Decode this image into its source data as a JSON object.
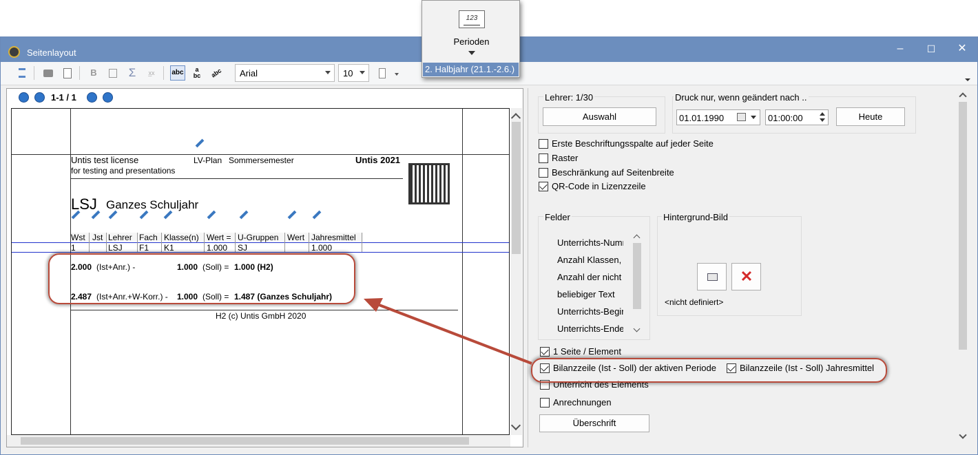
{
  "window": {
    "title": "Seitenlayout",
    "minimize": "–",
    "maximize": "☐",
    "close": "✕"
  },
  "toolbar": {
    "font": "Arial",
    "size": "10"
  },
  "popup": {
    "icon_text": "123",
    "label": "Perioden",
    "value": "2. Halbjahr (21.1.-2.6.)"
  },
  "preview": {
    "page_indicator": "1-1 / 1",
    "license1": "Untis test license",
    "license2": "for testing and presentations",
    "plan": "LV-Plan",
    "semester": "Sommersemester",
    "product": "Untis 2021",
    "code": "LSJ",
    "name": "Ganzes Schuljahr",
    "headers": [
      "Wst",
      "Jst",
      "Lehrer",
      "Fach",
      "Klasse(n)",
      "Wert =",
      "U-Gruppen",
      "Wert",
      "Jahresmittel"
    ],
    "row": [
      "1",
      "",
      "LSJ",
      "F1",
      "K1",
      "1.000",
      "SJ",
      "",
      "1.000"
    ],
    "bal1": {
      "v1": "2.000",
      "t1": "(Ist+Anr.) -",
      "v2": "1.000",
      "t2": "(Soll) =",
      "res": "1.000 (H2)"
    },
    "bal2": {
      "v1": "2.487",
      "t1": "(Ist+Anr.+W-Korr.) -",
      "v2": "1.000",
      "t2": "(Soll) =",
      "res": "1.487 (Ganzes Schuljahr)"
    },
    "footer": "H2   (c) Untis GmbH 2020"
  },
  "settings": {
    "teacher_label": "Lehrer: 1/30",
    "select_btn": "Auswahl",
    "print_label": "Druck nur, wenn geändert nach ..",
    "date": "01.01.1990",
    "time": "01:00:00",
    "today_btn": "Heute",
    "cb_first": "Erste Beschriftungsspalte auf jeder Seite",
    "cb_grid": "Raster",
    "cb_width": "Beschränkung auf Seitenbreite",
    "cb_qr": "QR-Code in Lizenzzeile",
    "fields_title": "Felder",
    "fields": [
      "Unterrichts-Numm",
      "Anzahl Klassen, l",
      "Anzahl der nicht v",
      "beliebiger Text",
      "Unterrichts-Begin",
      "Unterrichts-Ende"
    ],
    "bg_title": "Hintergrund-Bild",
    "bg_value": "<nicht definiert>",
    "cb_page": "1 Seite / Element",
    "cb_bal_period": "Bilanzzeile (Ist - Soll) der aktiven Periode",
    "cb_bal_year": "Bilanzzeile (Ist - Soll) Jahresmittel",
    "cb_unterricht": "Unterricht des Elements",
    "cb_anr": "Anrechnungen",
    "heading_btn": "Überschrift"
  },
  "colors": {
    "accent": "#6c8ebe",
    "highlight": "#b84a3a",
    "arrow": "#b84a3a"
  }
}
